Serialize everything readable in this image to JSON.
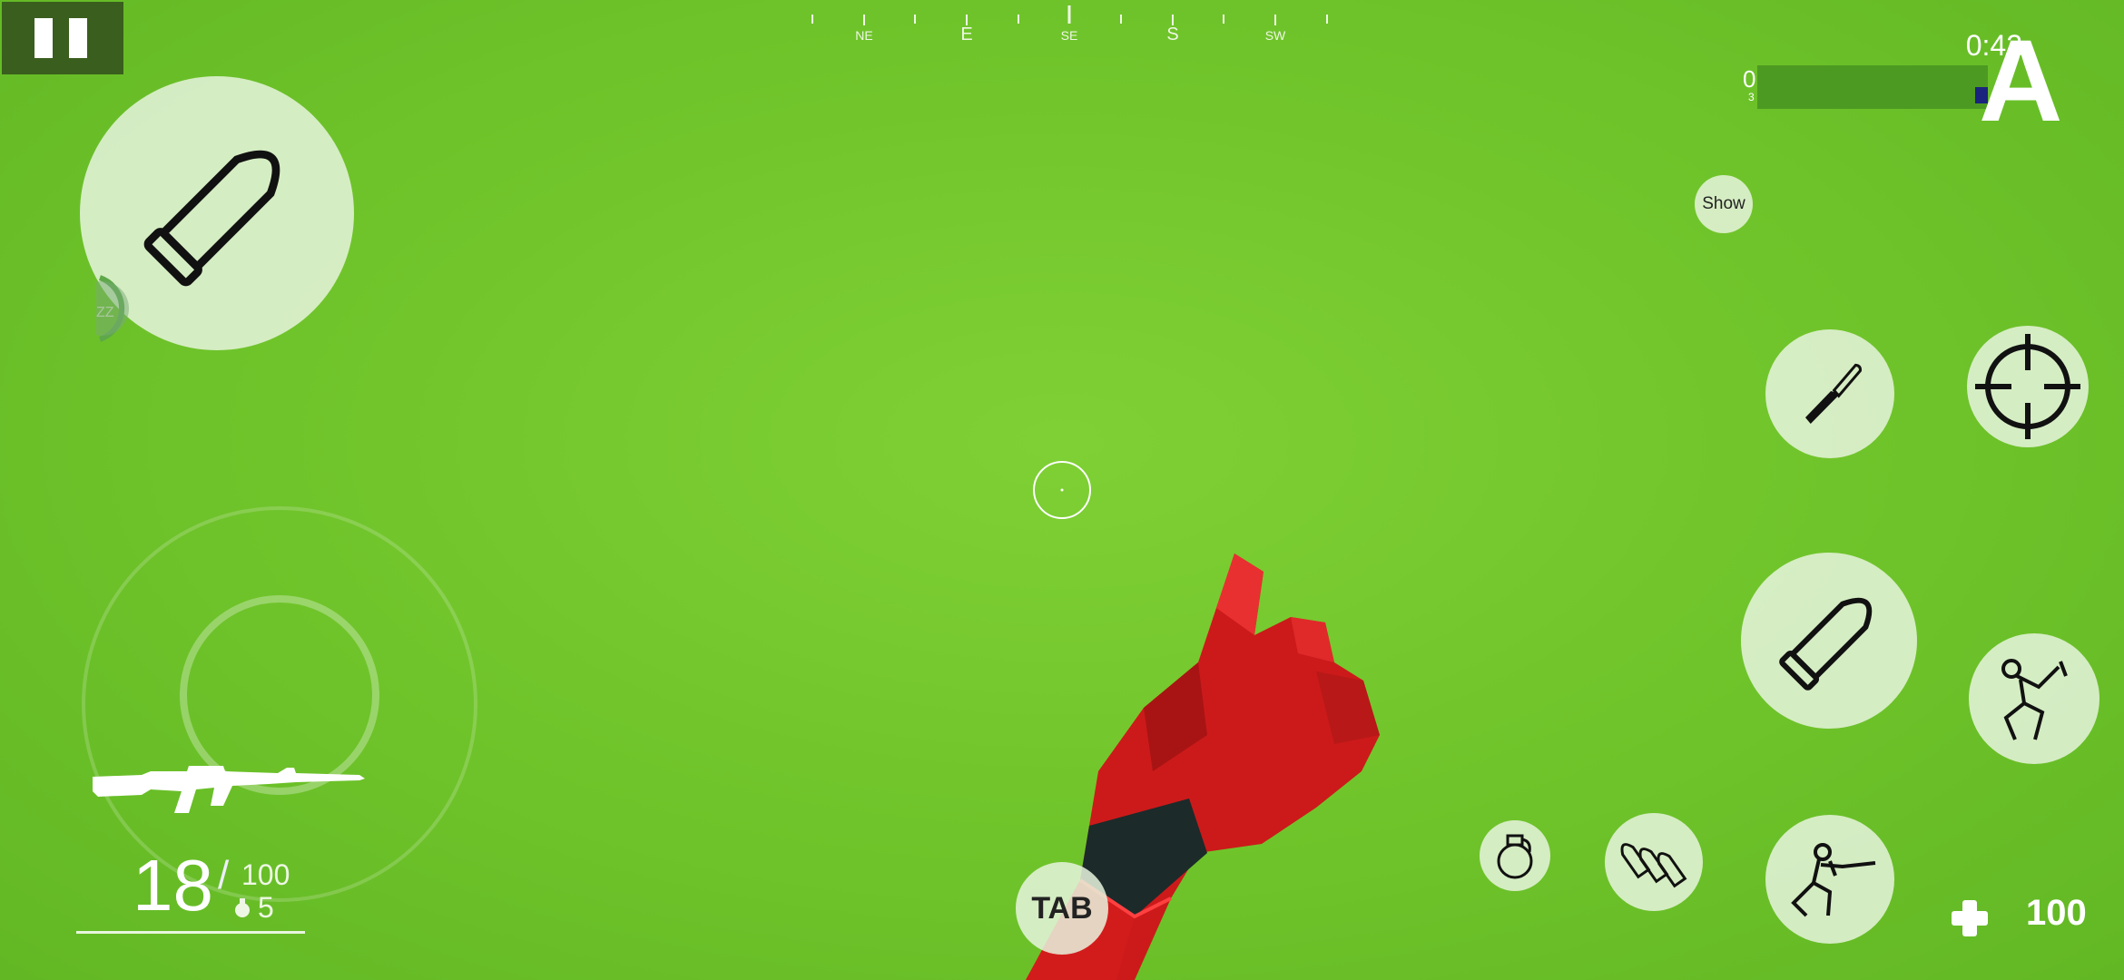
{
  "hud": {
    "timer": "0:42",
    "score_left": "0",
    "score_sub": "3",
    "team_letter": "A",
    "show_label": "Show",
    "tab_label": "TAB",
    "ammo_loaded": "18",
    "ammo_separator": "/",
    "ammo_reserve": "100",
    "grenades": "5",
    "health": "100",
    "sleep_label": "ZZ"
  },
  "compass": {
    "labels": [
      "NE",
      "E",
      "SE",
      "S",
      "SW"
    ]
  },
  "icons": {
    "pause": "pause-icon",
    "bullet": "bullet-icon",
    "knife": "knife-icon",
    "crosshair": "crosshair-icon",
    "grenade": "grenade-icon",
    "ammo": "ammo-icon",
    "crouch": "crouch-shoot-icon",
    "jump": "jump-icon",
    "health": "health-plus-icon",
    "rifle": "rifle-icon",
    "hand": "gloved-hand"
  },
  "colors": {
    "background": "#72c62c",
    "glove": "#cc1a1a",
    "score_fill": "#1a237e"
  }
}
